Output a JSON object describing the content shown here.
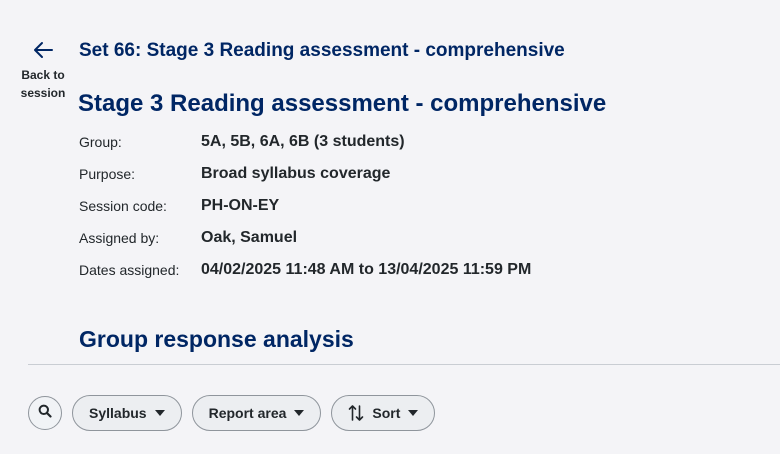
{
  "back": {
    "label": "Back to session",
    "icon": "arrow-left-icon"
  },
  "header": {
    "set_title": "Set 66: Stage 3 Reading assessment - comprehensive",
    "title": "Stage 3 Reading assessment - comprehensive"
  },
  "details": [
    {
      "label": "Group:",
      "value": "5A, 5B, 6A, 6B (3 students)"
    },
    {
      "label": "Purpose:",
      "value": "Broad syllabus coverage"
    },
    {
      "label": "Session code:",
      "value": "PH-ON-EY"
    },
    {
      "label": "Assigned by:",
      "value": "Oak, Samuel"
    },
    {
      "label": "Dates assigned:",
      "value": "04/02/2025 11:48 AM to 13/04/2025 11:59 PM"
    }
  ],
  "section": {
    "title": "Group response analysis"
  },
  "toolbar": {
    "search_icon": "search-icon",
    "syllabus_label": "Syllabus",
    "report_area_label": "Report area",
    "sort_label": "Sort",
    "sort_icon": "sort-arrows-icon",
    "dropdown_icon": "caret-down-icon"
  },
  "colors": {
    "heading": "#002664",
    "text": "#22272b",
    "background": "#f4f4f7",
    "border": "#8f959c"
  }
}
